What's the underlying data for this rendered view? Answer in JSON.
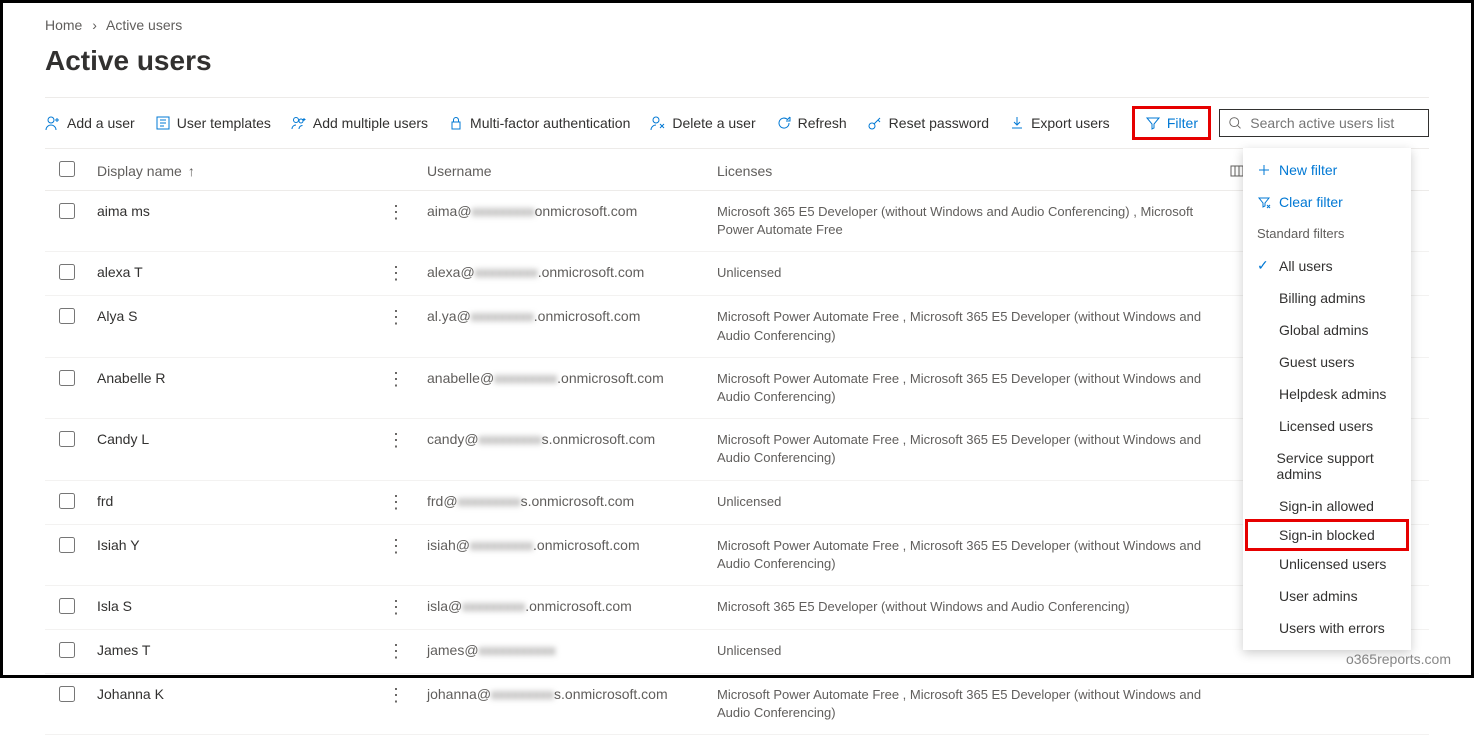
{
  "breadcrumb": {
    "home": "Home",
    "current": "Active users"
  },
  "title": "Active users",
  "toolbar": {
    "add_user": "Add a user",
    "user_templates": "User templates",
    "add_multiple": "Add multiple users",
    "mfa": "Multi-factor authentication",
    "delete_user": "Delete a user",
    "refresh": "Refresh",
    "reset_password": "Reset password",
    "export": "Export users",
    "filter": "Filter",
    "search_placeholder": "Search active users list"
  },
  "columns": {
    "display_name": "Display name",
    "username": "Username",
    "licenses": "Licenses",
    "choose": "Choose columns"
  },
  "rows": [
    {
      "name": "aima ms",
      "user_pre": "aima@",
      "user_blur": "xxxxxxxxx",
      "user_post": "onmicrosoft.com",
      "lic": "Microsoft 365 E5 Developer (without Windows and Audio Conferencing) , Microsoft Power Automate Free"
    },
    {
      "name": "alexa T",
      "user_pre": "alexa@",
      "user_blur": "xxxxxxxxx",
      "user_post": ".onmicrosoft.com",
      "lic": "Unlicensed"
    },
    {
      "name": "Alya S",
      "user_pre": "al.ya@",
      "user_blur": "xxxxxxxxx",
      "user_post": ".onmicrosoft.com",
      "lic": "Microsoft Power Automate Free , Microsoft 365 E5 Developer (without Windows and Audio Conferencing)"
    },
    {
      "name": "Anabelle R",
      "user_pre": "anabelle@",
      "user_blur": "xxxxxxxxx",
      "user_post": ".onmicrosoft.com",
      "lic": "Microsoft Power Automate Free , Microsoft 365 E5 Developer (without Windows and Audio Conferencing)"
    },
    {
      "name": "Candy L",
      "user_pre": "candy@",
      "user_blur": "xxxxxxxxx",
      "user_post": "s.onmicrosoft.com",
      "lic": "Microsoft Power Automate Free , Microsoft 365 E5 Developer (without Windows and Audio Conferencing)"
    },
    {
      "name": "frd",
      "user_pre": "frd@",
      "user_blur": "xxxxxxxxx",
      "user_post": "s.onmicrosoft.com",
      "lic": "Unlicensed"
    },
    {
      "name": "Isiah Y",
      "user_pre": "isiah@",
      "user_blur": "xxxxxxxxx",
      "user_post": ".onmicrosoft.com",
      "lic": "Microsoft Power Automate Free , Microsoft 365 E5 Developer (without Windows and Audio Conferencing)"
    },
    {
      "name": "Isla S",
      "user_pre": "isla@",
      "user_blur": "xxxxxxxxx",
      "user_post": ".onmicrosoft.com",
      "lic": "Microsoft 365 E5 Developer (without Windows and Audio Conferencing)"
    },
    {
      "name": "James T",
      "user_pre": "james@",
      "user_blur": "xxxxxxxxxxx",
      "user_post": "",
      "lic": "Unlicensed"
    },
    {
      "name": "Johanna K",
      "user_pre": "johanna@",
      "user_blur": "xxxxxxxxx",
      "user_post": "s.onmicrosoft.com",
      "lic": "Microsoft Power Automate Free , Microsoft 365 E5 Developer (without Windows and Audio Conferencing)"
    }
  ],
  "filter_menu": {
    "new_filter": "New filter",
    "clear_filter": "Clear filter",
    "header": "Standard filters",
    "items": [
      {
        "label": "All users",
        "checked": true
      },
      {
        "label": "Billing admins"
      },
      {
        "label": "Global admins"
      },
      {
        "label": "Guest users"
      },
      {
        "label": "Helpdesk admins"
      },
      {
        "label": "Licensed users"
      },
      {
        "label": "Service support admins"
      },
      {
        "label": "Sign-in allowed"
      },
      {
        "label": "Sign-in blocked",
        "highlighted": true
      },
      {
        "label": "Unlicensed users"
      },
      {
        "label": "User admins"
      },
      {
        "label": "Users with errors"
      }
    ]
  },
  "watermark": "o365reports.com"
}
